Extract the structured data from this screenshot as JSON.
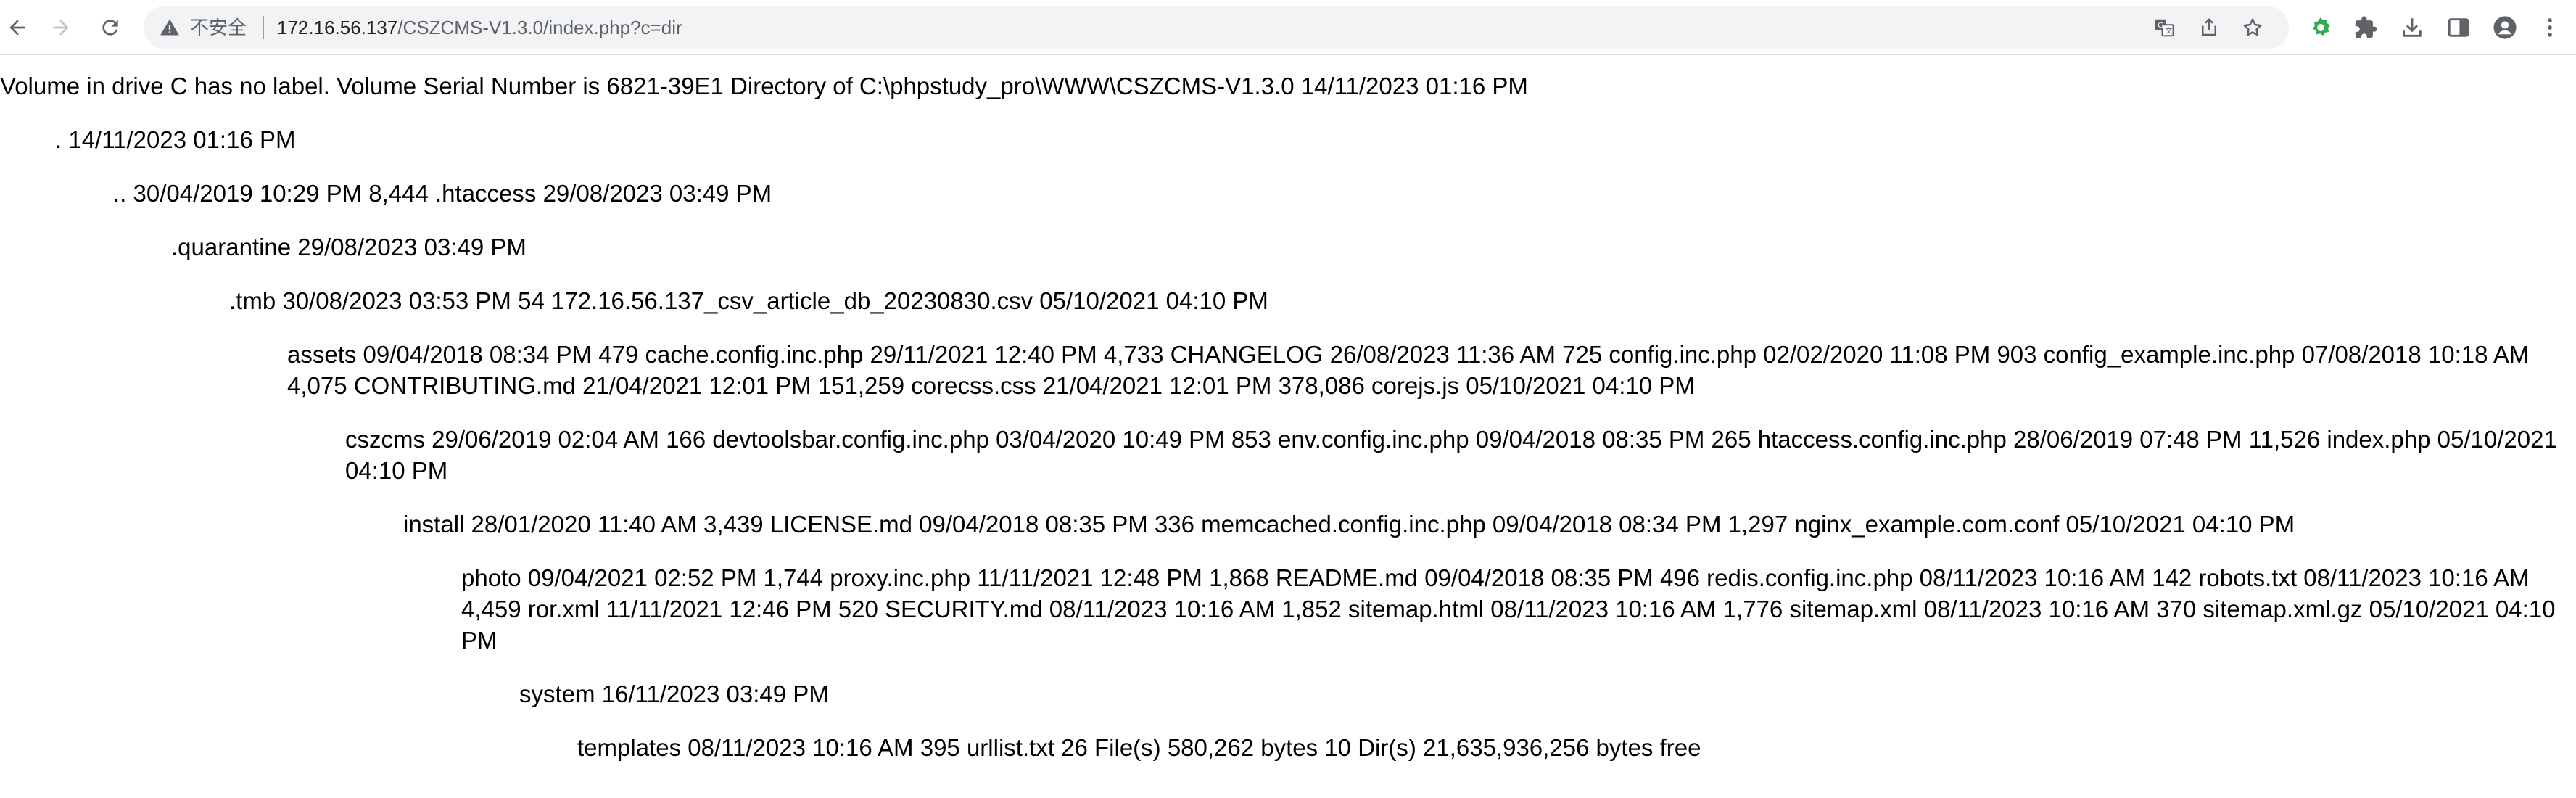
{
  "browser": {
    "security_label": "不安全",
    "url_host": "172.16.56.137",
    "url_path": "/CSZCMS-V1.3.0/index.php?c=dir",
    "icons": {
      "back": "back-arrow-icon",
      "forward": "forward-arrow-icon",
      "reload": "reload-icon",
      "warning": "warning-triangle-icon",
      "translate": "translate-icon",
      "share": "share-icon",
      "bookmark": "star-icon",
      "extension_1": "gear-extension-icon",
      "extensions": "puzzle-icon",
      "download": "download-icon",
      "side_panel": "side-panel-icon",
      "profile": "profile-icon",
      "menu": "kebab-menu-icon"
    },
    "colors": {
      "extension_green": "#34a853",
      "toolbar_icon": "#5f6368"
    }
  },
  "listing": {
    "lines": [
      "Volume in drive C has no label. Volume Serial Number is 6821-39E1 Directory of C:\\phpstudy_pro\\WWW\\CSZCMS-V1.3.0 14/11/2023 01:16 PM",
      ". 14/11/2023 01:16 PM",
      ".. 30/04/2019 10:29 PM 8,444 .htaccess 29/08/2023 03:49 PM",
      ".quarantine 29/08/2023 03:49 PM",
      ".tmb 30/08/2023 03:53 PM 54 172.16.56.137_csv_article_db_20230830.csv 05/10/2021 04:10 PM",
      "assets 09/04/2018 08:34 PM 479 cache.config.inc.php 29/11/2021 12:40 PM 4,733 CHANGELOG 26/08/2023 11:36 AM 725 config.inc.php 02/02/2020 11:08 PM 903 config_example.inc.php 07/08/2018 10:18 AM 4,075 CONTRIBUTING.md 21/04/2021 12:01 PM 151,259 corecss.css 21/04/2021 12:01 PM 378,086 corejs.js 05/10/2021 04:10 PM",
      "cszcms 29/06/2019 02:04 AM 166 devtoolsbar.config.inc.php 03/04/2020 10:49 PM 853 env.config.inc.php 09/04/2018 08:35 PM 265 htaccess.config.inc.php 28/06/2019 07:48 PM 11,526 index.php 05/10/2021 04:10 PM",
      "install 28/01/2020 11:40 AM 3,439 LICENSE.md 09/04/2018 08:35 PM 336 memcached.config.inc.php 09/04/2018 08:34 PM 1,297 nginx_example.com.conf 05/10/2021 04:10 PM",
      "photo 09/04/2021 02:52 PM 1,744 proxy.inc.php 11/11/2021 12:48 PM 1,868 README.md 09/04/2018 08:35 PM 496 redis.config.inc.php 08/11/2023 10:16 AM 142 robots.txt 08/11/2023 10:16 AM 4,459 ror.xml 11/11/2021 12:46 PM 520 SECURITY.md 08/11/2023 10:16 AM 1,852 sitemap.html 08/11/2023 10:16 AM 1,776 sitemap.xml 08/11/2023 10:16 AM 370 sitemap.xml.gz 05/10/2021 04:10 PM",
      "system 16/11/2023 03:49 PM",
      "templates 08/11/2023 10:16 AM 395 urllist.txt 26 File(s) 580,262 bytes 10 Dir(s) 21,635,936,256 bytes free"
    ]
  }
}
